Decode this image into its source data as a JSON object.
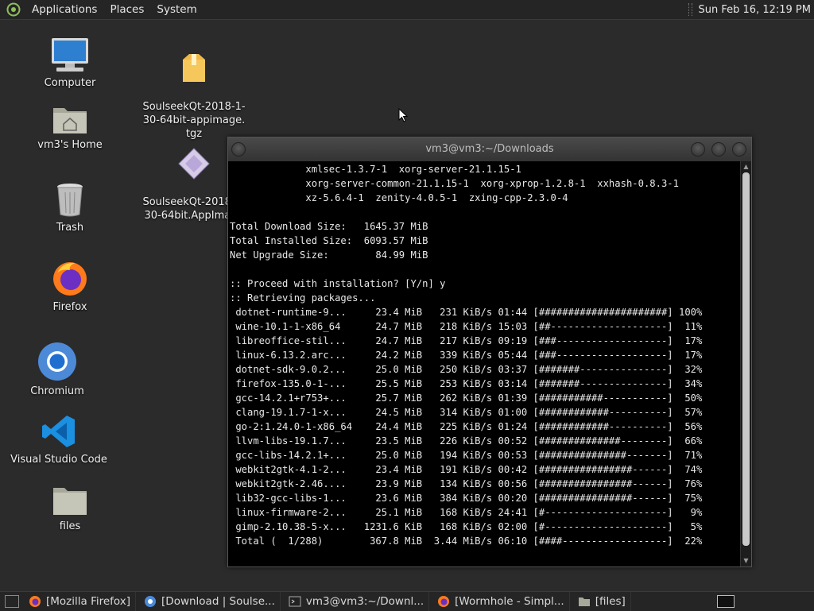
{
  "top_panel": {
    "menus": [
      "Applications",
      "Places",
      "System"
    ],
    "clock": "Sun Feb 16, 12:19 PM"
  },
  "desktop_icons": [
    {
      "label": "Computer",
      "icon": "computer-icon"
    },
    {
      "label": "vm3's Home",
      "icon": "home-folder-icon"
    },
    {
      "label": "Trash",
      "icon": "trash-icon"
    },
    {
      "label": "Firefox",
      "icon": "firefox-icon"
    },
    {
      "label": "Chromium",
      "icon": "chromium-icon"
    },
    {
      "label": "Visual Studio Code",
      "icon": "vscode-icon"
    },
    {
      "label": "files",
      "icon": "folder-icon"
    },
    {
      "label": "SoulseekQt-2018-1-\n30-64bit-appimage.\ntgz",
      "icon": "archive-icon"
    },
    {
      "label": "SoulseekQt-2018-1-\n30-64bit.AppImage",
      "icon": "appimage-icon"
    }
  ],
  "terminal": {
    "title": "vm3@vm3:~/Downloads",
    "lines": [
      "             xmlsec-1.3.7-1  xorg-server-21.1.15-1",
      "             xorg-server-common-21.1.15-1  xorg-xprop-1.2.8-1  xxhash-0.8.3-1",
      "             xz-5.6.4-1  zenity-4.0.5-1  zxing-cpp-2.3.0-4",
      "",
      "Total Download Size:   1645.37 MiB",
      "Total Installed Size:  6093.57 MiB",
      "Net Upgrade Size:        84.99 MiB",
      "",
      ":: Proceed with installation? [Y/n] y",
      ":: Retrieving packages...",
      " dotnet-runtime-9...     23.4 MiB   231 KiB/s 01:44 [######################] 100%",
      " wine-10.1-1-x86_64      24.7 MiB   218 KiB/s 15:03 [##--------------------]  11%",
      " libreoffice-stil...     24.7 MiB   217 KiB/s 09:19 [###-------------------]  17%",
      " linux-6.13.2.arc...     24.2 MiB   339 KiB/s 05:44 [###-------------------]  17%",
      " dotnet-sdk-9.0.2...     25.0 MiB   250 KiB/s 03:37 [#######---------------]  32%",
      " firefox-135.0-1-...     25.5 MiB   253 KiB/s 03:14 [#######---------------]  34%",
      " gcc-14.2.1+r753+...     25.7 MiB   262 KiB/s 01:39 [###########-----------]  50%",
      " clang-19.1.7-1-x...     24.5 MiB   314 KiB/s 01:00 [############----------]  57%",
      " go-2:1.24.0-1-x86_64    24.4 MiB   225 KiB/s 01:24 [############----------]  56%",
      " llvm-libs-19.1.7...     23.5 MiB   226 KiB/s 00:52 [##############--------]  66%",
      " gcc-libs-14.2.1+...     25.0 MiB   194 KiB/s 00:53 [###############-------]  71%",
      " webkit2gtk-4.1-2...     23.4 MiB   191 KiB/s 00:42 [################------]  74%",
      " webkit2gtk-2.46....     23.9 MiB   134 KiB/s 00:56 [################------]  76%",
      " lib32-gcc-libs-1...     23.6 MiB   384 KiB/s 00:20 [################------]  75%",
      " linux-firmware-2...     25.1 MiB   168 KiB/s 24:41 [#---------------------]   9%",
      " gimp-2.10.38-5-x...   1231.6 KiB   168 KiB/s 02:00 [#---------------------]   5%",
      " Total (  1/288)        367.8 MiB  3.44 MiB/s 06:10 [####------------------]  22%"
    ]
  },
  "taskbar": {
    "tasks": [
      {
        "label": "[Mozilla Firefox]",
        "icon": "firefox-icon"
      },
      {
        "label": "[Download | Soulse...",
        "icon": "chromium-icon"
      },
      {
        "label": "vm3@vm3:~/Downl...",
        "icon": "terminal-icon"
      },
      {
        "label": "[Wormhole - Simpl...",
        "icon": "firefox-icon"
      },
      {
        "label": "[files]",
        "icon": "folder-icon"
      }
    ]
  }
}
